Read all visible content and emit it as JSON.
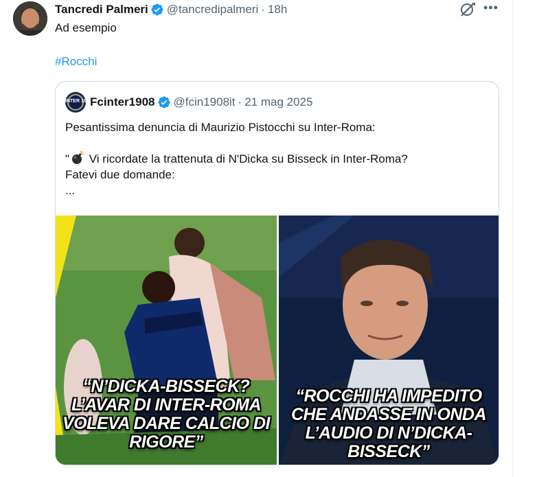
{
  "tweet": {
    "author_name": "Tancredi Palmeri",
    "handle": "@tancredipalmeri",
    "separator": "·",
    "time": "18h",
    "text": "Ad esempio",
    "hashtag": "#Rocchi",
    "more_label": "•••"
  },
  "quoted": {
    "author_name": "Fcinter1908",
    "handle": "@fcin1908it",
    "separator": "·",
    "date": "21 mag 2025",
    "avatar_text": "INTER 1908.IT",
    "lines": [
      "Pesantissima denuncia di Maurizio Pistocchi su Inter-Roma:",
      "\"",
      " Vi ricordate la trattenuta di N'Dicka su Bisseck in Inter-Roma?",
      "Fatevi due domande:",
      "..."
    ],
    "image_left_caption": "“N’DICKA-BISSECK? L’AVAR DI INTER-ROMA VOLEVA DARE CALCIO DI RIGORE”",
    "image_right_caption": "“ROCCHI HA IMPEDITO CHE ANDASSE IN ONDA L’AUDIO DI N’DICKA-BISSECK”"
  },
  "colors": {
    "accent": "#1d9bf0",
    "text": "#0f1419",
    "secondary": "#536471",
    "border": "#cfd9de"
  },
  "icons": {
    "verified": "verified-badge-icon",
    "grok": "grok-icon",
    "more": "more-icon",
    "bomb": "bomb-emoji-icon"
  }
}
